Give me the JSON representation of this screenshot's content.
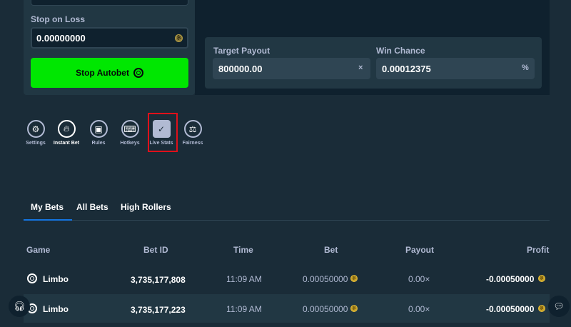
{
  "autobet": {
    "stop_on_loss_label": "Stop on Loss",
    "stop_on_loss_value": "0.00000000",
    "stop_button_label": "Stop Autobet"
  },
  "payout": {
    "target_payout_label": "Target Payout",
    "target_payout_value": "800000.00",
    "target_payout_suffix": "×",
    "win_chance_label": "Win Chance",
    "win_chance_value": "0.00012375",
    "win_chance_suffix": "%"
  },
  "toolbar": {
    "items": [
      {
        "label": "Settings",
        "icon": "gear-icon"
      },
      {
        "label": "Instant Bet",
        "icon": "flame-icon"
      },
      {
        "label": "Rules",
        "icon": "book-icon"
      },
      {
        "label": "Hotkeys",
        "icon": "keyboard-icon"
      },
      {
        "label": "Live Stats",
        "icon": "chart-icon"
      },
      {
        "label": "Fairness",
        "icon": "scale-icon"
      }
    ]
  },
  "tabs": [
    "My Bets",
    "All Bets",
    "High Rollers"
  ],
  "table": {
    "headers": [
      "Game",
      "Bet ID",
      "Time",
      "Bet",
      "Payout",
      "Profit"
    ],
    "rows": [
      {
        "game": "Limbo",
        "bet_id": "3,735,177,808",
        "time": "11:09 AM",
        "bet": "0.00050000",
        "payout": "0.00×",
        "profit": "-0.00050000"
      },
      {
        "game": "Limbo",
        "bet_id": "3,735,177,223",
        "time": "11:09 AM",
        "bet": "0.00050000",
        "payout": "0.00×",
        "profit": "-0.00050000"
      }
    ]
  },
  "colors": {
    "background": "#1a2c38",
    "panel": "#213743",
    "input": "#0f212e",
    "accent_green": "#00e701",
    "tab_underline": "#1475e1",
    "highlight_red": "#e0101a"
  }
}
